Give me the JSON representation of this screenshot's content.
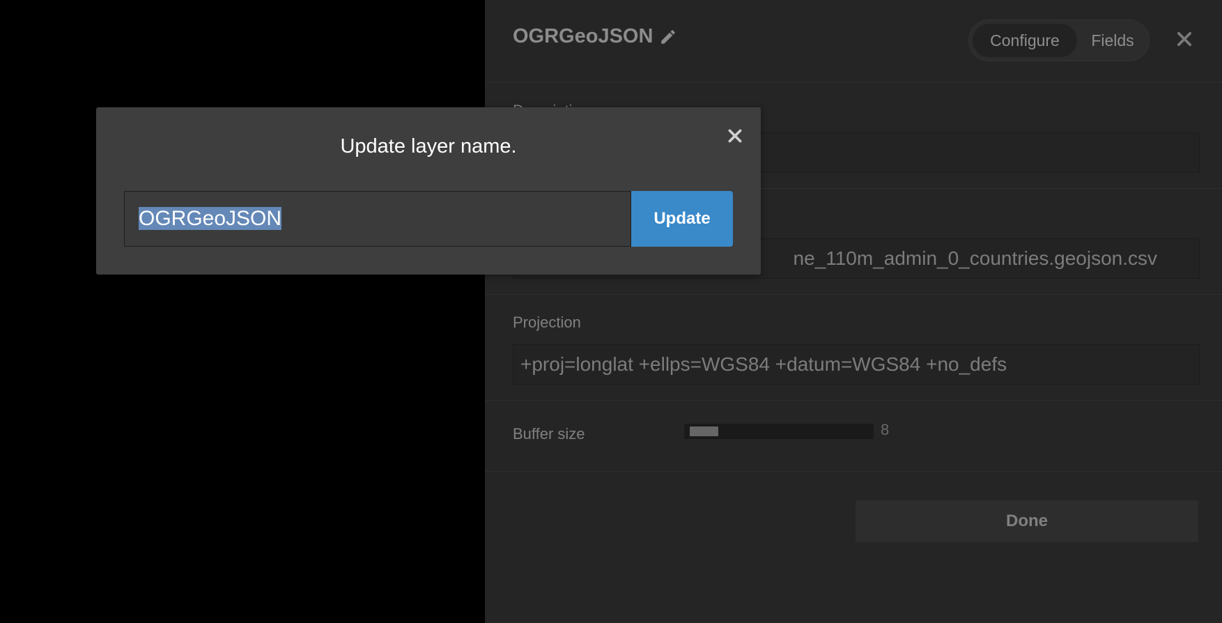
{
  "panel": {
    "layer_name": "OGRGeoJSON",
    "tabs": [
      "Configure",
      "Fields"
    ],
    "description_label": "Description",
    "description_value": "",
    "file_value": "ne_110m_admin_0_countries.geojson.csv",
    "projection_label": "Projection",
    "projection_value": "+proj=longlat +ellps=WGS84 +datum=WGS84 +no_defs",
    "buffer_label": "Buffer size",
    "buffer_value": "8",
    "buffer_fraction": 0.16,
    "done_label": "Done"
  },
  "modal": {
    "title": "Update layer name.",
    "input_value": "OGRGeoJSON",
    "update_label": "Update"
  },
  "colors": {
    "accent": "#3a89c9",
    "selection": "#6488b7",
    "panel_bg": "#252525"
  }
}
